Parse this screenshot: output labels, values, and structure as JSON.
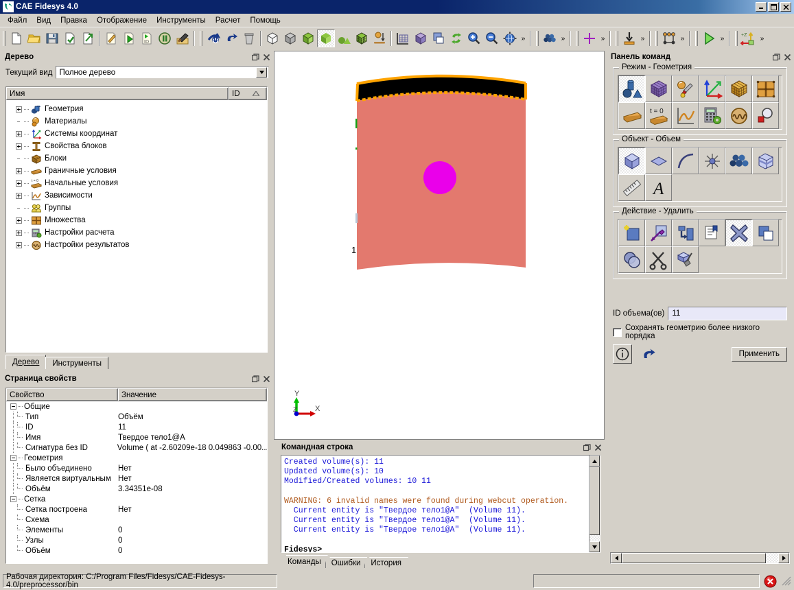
{
  "window": {
    "title": "CAE Fidesys 4.0",
    "icon": "app-logo-icon",
    "minimize": "_",
    "maximize": "□",
    "close": "✕"
  },
  "menubar": {
    "items": [
      {
        "label": "Файл",
        "name": "menu-file"
      },
      {
        "label": "Вид",
        "name": "menu-view"
      },
      {
        "label": "Правка",
        "name": "menu-edit"
      },
      {
        "label": "Отображение",
        "name": "menu-display"
      },
      {
        "label": "Инструменты",
        "name": "menu-tools"
      },
      {
        "label": "Расчет",
        "name": "menu-calculation"
      },
      {
        "label": "Помощь",
        "name": "menu-help"
      }
    ]
  },
  "toolbar": {
    "overflow_label": "»",
    "groups": [
      {
        "buttons": [
          "new-file-icon",
          "open-folder-icon",
          "save-disk-icon",
          "import-journal-icon",
          "export-journal-icon"
        ]
      },
      {
        "buttons": [
          "edit-journal-icon",
          "play-journal-icon",
          "journal-id-icon",
          "pause-icon",
          "build-hammer-icon"
        ]
      },
      {
        "buttons": [
          "reset-power-icon",
          "undo-arrow-icon",
          "delete-trash-icon"
        ]
      },
      {
        "buttons": [
          "wireframe-cube-icon",
          "hidden-line-cube-icon",
          "shaded-cube-icon",
          "smooth-shade-icon",
          "primitives-icon",
          "mesh-cube-icon",
          "gravity-icon"
        ]
      },
      {
        "buttons": [
          "grid-axes-icon",
          "transparency-cube-icon",
          "clipping-plane-icon",
          "refresh-icon",
          "zoom-in-icon",
          "zoom-out-icon",
          "fit-globe-icon"
        ]
      },
      {
        "buttons": [
          "select-volumes-icon"
        ]
      },
      {
        "buttons": [
          "vertex-marker-icon"
        ]
      },
      {
        "buttons": [
          "surface-down-icon"
        ]
      },
      {
        "buttons": [
          "edges-frame-icon"
        ]
      },
      {
        "buttons": [
          "run-solver-icon"
        ]
      },
      {
        "buttons": [
          "z-axis-view-icon"
        ]
      }
    ]
  },
  "tree_panel": {
    "title": "Дерево",
    "float_btn": "restore-icon",
    "close_btn": "close-icon",
    "view_label": "Текущий вид",
    "view_value": "Полное дерево",
    "columns": [
      "Имя",
      "ID"
    ],
    "sort_indicator": "▲",
    "nodes": [
      {
        "label": "Геометрия",
        "icon": "geometry-icon",
        "expandable": true
      },
      {
        "label": "Материалы",
        "icon": "materials-icon",
        "expandable": false
      },
      {
        "label": "Системы координат",
        "icon": "coordinate-systems-icon",
        "expandable": true
      },
      {
        "label": "Свойства блоков",
        "icon": "block-properties-icon",
        "expandable": true
      },
      {
        "label": "Блоки",
        "icon": "blocks-icon",
        "expandable": false
      },
      {
        "label": "Граничные условия",
        "icon": "boundary-conditions-icon",
        "expandable": true
      },
      {
        "label": "Начальные условия",
        "icon": "initial-conditions-icon",
        "expandable": true
      },
      {
        "label": "Зависимости",
        "icon": "dependencies-icon",
        "expandable": true
      },
      {
        "label": "Группы",
        "icon": "groups-icon",
        "expandable": false
      },
      {
        "label": "Множества",
        "icon": "sets-icon",
        "expandable": true
      },
      {
        "label": "Настройки расчета",
        "icon": "calculation-settings-icon",
        "expandable": true
      },
      {
        "label": "Настройки результатов",
        "icon": "results-settings-icon",
        "expandable": true
      }
    ],
    "tabs": [
      {
        "label": "Дерево",
        "active": true
      },
      {
        "label": "Инструменты",
        "active": false
      }
    ]
  },
  "properties_panel": {
    "title": "Страница свойств",
    "columns": [
      "Свойство",
      "Значение"
    ],
    "groups": [
      {
        "label": "Общие",
        "rows": [
          {
            "key": "Тип",
            "value": "Объём"
          },
          {
            "key": "ID",
            "value": "11"
          },
          {
            "key": "Имя",
            "value": "Твердое тело1@A"
          },
          {
            "key": "Сигнатура без ID",
            "value": "Volume ( at -2.60209e-18 0.049863 -0.00..."
          }
        ]
      },
      {
        "label": "Геометрия",
        "rows": [
          {
            "key": "Было объединено",
            "value": "Нет"
          },
          {
            "key": "Является виртуальным",
            "value": "Нет"
          },
          {
            "key": "Объём",
            "value": "3.34351e-08"
          }
        ]
      },
      {
        "label": "Сетка",
        "rows": [
          {
            "key": "Сетка построена",
            "value": "Нет"
          },
          {
            "key": "Схема",
            "value": ""
          },
          {
            "key": "Элементы",
            "value": "0"
          },
          {
            "key": "Узлы",
            "value": "0"
          },
          {
            "key": "Объём",
            "value": "0"
          }
        ]
      }
    ]
  },
  "viewport": {
    "axis_x": "X",
    "axis_y": "Y",
    "axis_z": "Z",
    "colors": {
      "body": "#e3796e",
      "highlight": "#ffa300",
      "selected_face": "#000000",
      "marker": "#ea00ea",
      "background": "#ffffff"
    },
    "label_1": "1"
  },
  "console_panel": {
    "title": "Командная строка",
    "lines": [
      {
        "text": "Created volume(s): 11",
        "style": "blue"
      },
      {
        "text": "Updated volume(s): 10",
        "style": "blue"
      },
      {
        "text": "Modified/Created volumes: 10 11",
        "style": "blue"
      },
      {
        "text": "",
        "style": "blue"
      },
      {
        "text": "WARNING: 6 invalid names were found during webcut operation.",
        "style": "warn"
      },
      {
        "text": "  Current entity is \"Твердое тело1@A\"  (Volume 11).",
        "style": "blue"
      },
      {
        "text": "  Current entity is \"Твердое тело1@A\"  (Volume 11).",
        "style": "blue"
      },
      {
        "text": "  Current entity is \"Твердое тело1@A\"  (Volume 11).",
        "style": "blue"
      },
      {
        "text": "",
        "style": "blue"
      },
      {
        "text": "Fidesys>",
        "style": "prompt"
      }
    ],
    "tabs": [
      {
        "label": "Команды",
        "active": true
      },
      {
        "label": "Ошибки",
        "active": false
      },
      {
        "label": "История",
        "active": false
      }
    ]
  },
  "command_panel": {
    "title": "Панель команд",
    "mode_group": {
      "label": "Режим - Геометрия",
      "buttons": [
        {
          "name": "mode-geometry-icon",
          "checked": true
        },
        {
          "name": "mode-mesh-icon",
          "checked": false
        },
        {
          "name": "mode-material-icon",
          "checked": false
        },
        {
          "name": "mode-coordinate-system-icon",
          "checked": false
        },
        {
          "name": "mode-blocks-icon",
          "checked": false
        },
        {
          "name": "mode-sets-icon",
          "checked": false
        },
        {
          "name": "mode-boundary-conditions-icon",
          "checked": false
        },
        {
          "name": "mode-initial-conditions-icon",
          "checked": false
        },
        {
          "name": "mode-dependencies-icon",
          "checked": false
        },
        {
          "name": "mode-calculation-settings-icon",
          "checked": false
        },
        {
          "name": "mode-results-settings-icon",
          "checked": false
        },
        {
          "name": "mode-inspect-icon",
          "checked": false
        }
      ]
    },
    "object_group": {
      "label": "Объект - Объем",
      "buttons": [
        {
          "name": "object-volume-icon",
          "checked": true
        },
        {
          "name": "object-surface-icon",
          "checked": false
        },
        {
          "name": "object-curve-icon",
          "checked": false
        },
        {
          "name": "object-vertex-icon",
          "checked": false
        },
        {
          "name": "object-group-icon",
          "checked": false
        },
        {
          "name": "object-body-icon",
          "checked": false
        },
        {
          "name": "object-measure-icon",
          "checked": false
        },
        {
          "name": "object-text-icon",
          "checked": false
        }
      ]
    },
    "action_group": {
      "label": "Действие - Удалить",
      "buttons": [
        {
          "name": "action-create-icon",
          "checked": false
        },
        {
          "name": "action-modify-icon",
          "checked": false
        },
        {
          "name": "action-transform-icon",
          "checked": false
        },
        {
          "name": "action-properties-icon",
          "checked": false
        },
        {
          "name": "action-delete-icon",
          "checked": true
        },
        {
          "name": "action-copy-icon",
          "checked": false
        },
        {
          "name": "action-boolean-icon",
          "checked": false
        },
        {
          "name": "action-webcut-icon",
          "checked": false
        },
        {
          "name": "action-cleanup-icon",
          "checked": false
        }
      ]
    },
    "volume_id_label": "ID объема(ов)",
    "volume_id_value": "11",
    "keep_lower_order_label": "Сохранять геометрию более низкого порядка",
    "keep_lower_order_checked": false,
    "info_btn": "info-icon",
    "reset_btn": "undo-icon",
    "apply_btn": "Применить",
    "scroll_left": "◄",
    "scroll_right": "►"
  },
  "statusbar": {
    "working_dir": "Рабочая директория: C:/Program Files/Fidesys/CAE-Fidesys-4.0/preprocessor/bin",
    "progress_value": "",
    "stop_btn": "stop-icon"
  }
}
